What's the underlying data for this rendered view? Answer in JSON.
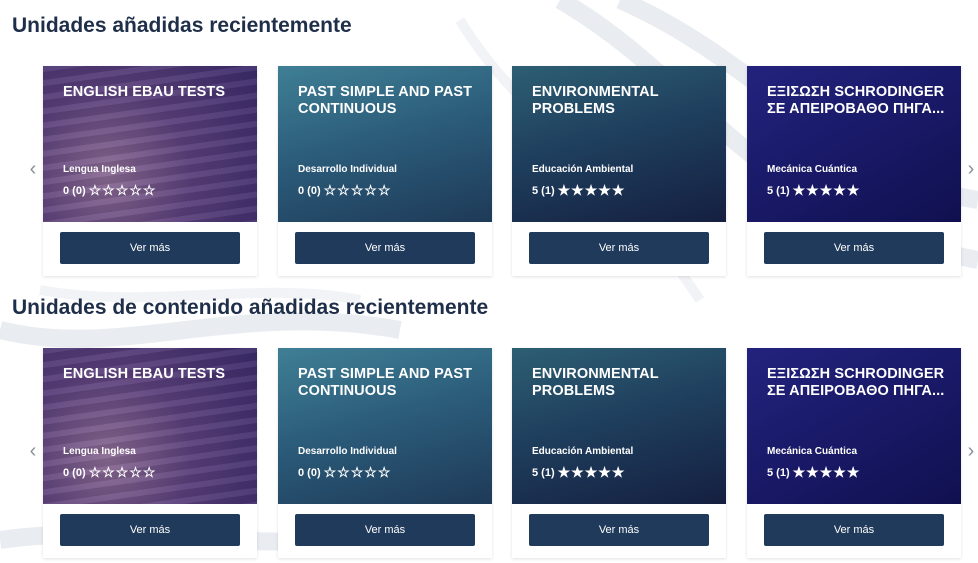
{
  "sections": [
    {
      "title": "Unidades añadidas recientemente",
      "cards": [
        {
          "title": "ENGLISH EBAU TESTS",
          "subject": "Lengua Inglesa",
          "rating": "0 (0)",
          "stars": "☆☆☆☆☆",
          "button": "Ver más"
        },
        {
          "title": "PAST SIMPLE AND PAST CONTINUOUS",
          "subject": "Desarrollo Individual",
          "rating": "0 (0)",
          "stars": "☆☆☆☆☆",
          "button": "Ver más"
        },
        {
          "title": "ENVIRONMENTAL PROBLEMS",
          "subject": "Educación Ambiental",
          "rating": "5 (1)",
          "stars": "★★★★★",
          "button": "Ver más"
        },
        {
          "title": "ΕΞΙΣΩΣΗ SCHRODINGER ΣΕ ΑΠΕΙΡΟΒΑΘΟ ΠΗΓΑ...",
          "subject": "Mecánica Cuántica",
          "rating": "5 (1)",
          "stars": "★★★★★",
          "button": "Ver más"
        }
      ]
    },
    {
      "title": "Unidades de contenido añadidas recientemente",
      "cards": [
        {
          "title": "ENGLISH EBAU TESTS",
          "subject": "Lengua Inglesa",
          "rating": "0 (0)",
          "stars": "☆☆☆☆☆",
          "button": "Ver más"
        },
        {
          "title": "PAST SIMPLE AND PAST CONTINUOUS",
          "subject": "Desarrollo Individual",
          "rating": "0 (0)",
          "stars": "☆☆☆☆☆",
          "button": "Ver más"
        },
        {
          "title": "ENVIRONMENTAL PROBLEMS",
          "subject": "Educación Ambiental",
          "rating": "5 (1)",
          "stars": "★★★★★",
          "button": "Ver más"
        },
        {
          "title": "ΕΞΙΣΩΣΗ SCHRODINGER ΣΕ ΑΠΕΙΡΟΒΑΘΟ ΠΗΓΑ...",
          "subject": "Mecánica Cuántica",
          "rating": "5 (1)",
          "stars": "★★★★★",
          "button": "Ver más"
        }
      ]
    }
  ],
  "icons": {
    "prev": "chevron-left-icon",
    "next": "chevron-right-icon"
  },
  "colors": {
    "heading": "#1f2f4a",
    "button": "#1f3a5a"
  }
}
